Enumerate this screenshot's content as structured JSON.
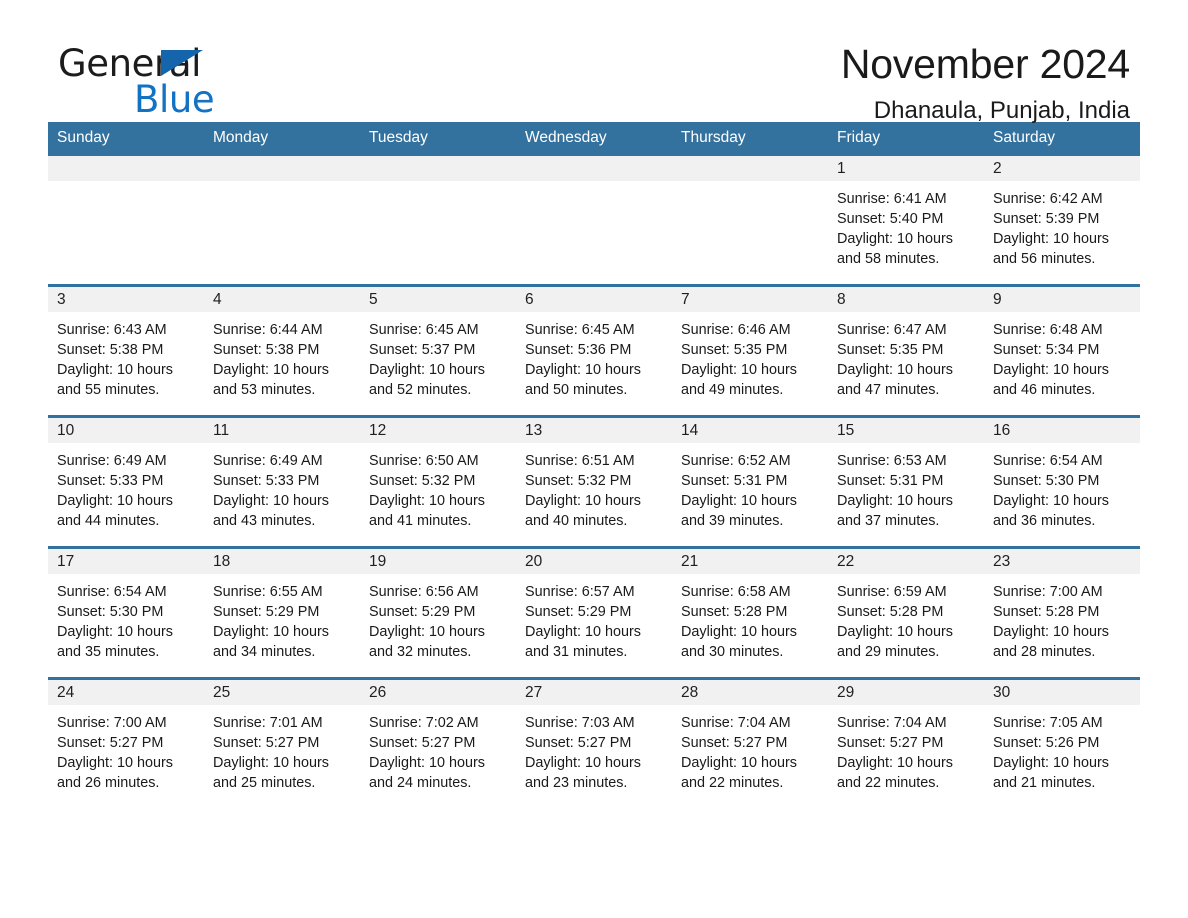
{
  "brand": {
    "line1": "General",
    "line2": "Blue",
    "triangle_icon": "triangle-icon",
    "accent_color": "#1272c4"
  },
  "header": {
    "title": "November 2024",
    "subtitle": "Dhanaula, Punjab, India"
  },
  "theme": {
    "header_blue": "#33719e",
    "daynum_band": "#f1f1f1",
    "text": "#1a1a1a"
  },
  "calendar": {
    "weekday_headers": [
      "Sunday",
      "Monday",
      "Tuesday",
      "Wednesday",
      "Thursday",
      "Friday",
      "Saturday"
    ],
    "weeks": [
      [
        {
          "day": "",
          "empty": true
        },
        {
          "day": "",
          "empty": true
        },
        {
          "day": "",
          "empty": true
        },
        {
          "day": "",
          "empty": true
        },
        {
          "day": "",
          "empty": true
        },
        {
          "day": "1",
          "sunrise": "Sunrise: 6:41 AM",
          "sunset": "Sunset: 5:40 PM",
          "daylight": "Daylight: 10 hours and 58 minutes."
        },
        {
          "day": "2",
          "sunrise": "Sunrise: 6:42 AM",
          "sunset": "Sunset: 5:39 PM",
          "daylight": "Daylight: 10 hours and 56 minutes."
        }
      ],
      [
        {
          "day": "3",
          "sunrise": "Sunrise: 6:43 AM",
          "sunset": "Sunset: 5:38 PM",
          "daylight": "Daylight: 10 hours and 55 minutes."
        },
        {
          "day": "4",
          "sunrise": "Sunrise: 6:44 AM",
          "sunset": "Sunset: 5:38 PM",
          "daylight": "Daylight: 10 hours and 53 minutes."
        },
        {
          "day": "5",
          "sunrise": "Sunrise: 6:45 AM",
          "sunset": "Sunset: 5:37 PM",
          "daylight": "Daylight: 10 hours and 52 minutes."
        },
        {
          "day": "6",
          "sunrise": "Sunrise: 6:45 AM",
          "sunset": "Sunset: 5:36 PM",
          "daylight": "Daylight: 10 hours and 50 minutes."
        },
        {
          "day": "7",
          "sunrise": "Sunrise: 6:46 AM",
          "sunset": "Sunset: 5:35 PM",
          "daylight": "Daylight: 10 hours and 49 minutes."
        },
        {
          "day": "8",
          "sunrise": "Sunrise: 6:47 AM",
          "sunset": "Sunset: 5:35 PM",
          "daylight": "Daylight: 10 hours and 47 minutes."
        },
        {
          "day": "9",
          "sunrise": "Sunrise: 6:48 AM",
          "sunset": "Sunset: 5:34 PM",
          "daylight": "Daylight: 10 hours and 46 minutes."
        }
      ],
      [
        {
          "day": "10",
          "sunrise": "Sunrise: 6:49 AM",
          "sunset": "Sunset: 5:33 PM",
          "daylight": "Daylight: 10 hours and 44 minutes."
        },
        {
          "day": "11",
          "sunrise": "Sunrise: 6:49 AM",
          "sunset": "Sunset: 5:33 PM",
          "daylight": "Daylight: 10 hours and 43 minutes."
        },
        {
          "day": "12",
          "sunrise": "Sunrise: 6:50 AM",
          "sunset": "Sunset: 5:32 PM",
          "daylight": "Daylight: 10 hours and 41 minutes."
        },
        {
          "day": "13",
          "sunrise": "Sunrise: 6:51 AM",
          "sunset": "Sunset: 5:32 PM",
          "daylight": "Daylight: 10 hours and 40 minutes."
        },
        {
          "day": "14",
          "sunrise": "Sunrise: 6:52 AM",
          "sunset": "Sunset: 5:31 PM",
          "daylight": "Daylight: 10 hours and 39 minutes."
        },
        {
          "day": "15",
          "sunrise": "Sunrise: 6:53 AM",
          "sunset": "Sunset: 5:31 PM",
          "daylight": "Daylight: 10 hours and 37 minutes."
        },
        {
          "day": "16",
          "sunrise": "Sunrise: 6:54 AM",
          "sunset": "Sunset: 5:30 PM",
          "daylight": "Daylight: 10 hours and 36 minutes."
        }
      ],
      [
        {
          "day": "17",
          "sunrise": "Sunrise: 6:54 AM",
          "sunset": "Sunset: 5:30 PM",
          "daylight": "Daylight: 10 hours and 35 minutes."
        },
        {
          "day": "18",
          "sunrise": "Sunrise: 6:55 AM",
          "sunset": "Sunset: 5:29 PM",
          "daylight": "Daylight: 10 hours and 34 minutes."
        },
        {
          "day": "19",
          "sunrise": "Sunrise: 6:56 AM",
          "sunset": "Sunset: 5:29 PM",
          "daylight": "Daylight: 10 hours and 32 minutes."
        },
        {
          "day": "20",
          "sunrise": "Sunrise: 6:57 AM",
          "sunset": "Sunset: 5:29 PM",
          "daylight": "Daylight: 10 hours and 31 minutes."
        },
        {
          "day": "21",
          "sunrise": "Sunrise: 6:58 AM",
          "sunset": "Sunset: 5:28 PM",
          "daylight": "Daylight: 10 hours and 30 minutes."
        },
        {
          "day": "22",
          "sunrise": "Sunrise: 6:59 AM",
          "sunset": "Sunset: 5:28 PM",
          "daylight": "Daylight: 10 hours and 29 minutes."
        },
        {
          "day": "23",
          "sunrise": "Sunrise: 7:00 AM",
          "sunset": "Sunset: 5:28 PM",
          "daylight": "Daylight: 10 hours and 28 minutes."
        }
      ],
      [
        {
          "day": "24",
          "sunrise": "Sunrise: 7:00 AM",
          "sunset": "Sunset: 5:27 PM",
          "daylight": "Daylight: 10 hours and 26 minutes."
        },
        {
          "day": "25",
          "sunrise": "Sunrise: 7:01 AM",
          "sunset": "Sunset: 5:27 PM",
          "daylight": "Daylight: 10 hours and 25 minutes."
        },
        {
          "day": "26",
          "sunrise": "Sunrise: 7:02 AM",
          "sunset": "Sunset: 5:27 PM",
          "daylight": "Daylight: 10 hours and 24 minutes."
        },
        {
          "day": "27",
          "sunrise": "Sunrise: 7:03 AM",
          "sunset": "Sunset: 5:27 PM",
          "daylight": "Daylight: 10 hours and 23 minutes."
        },
        {
          "day": "28",
          "sunrise": "Sunrise: 7:04 AM",
          "sunset": "Sunset: 5:27 PM",
          "daylight": "Daylight: 10 hours and 22 minutes."
        },
        {
          "day": "29",
          "sunrise": "Sunrise: 7:04 AM",
          "sunset": "Sunset: 5:27 PM",
          "daylight": "Daylight: 10 hours and 22 minutes."
        },
        {
          "day": "30",
          "sunrise": "Sunrise: 7:05 AM",
          "sunset": "Sunset: 5:26 PM",
          "daylight": "Daylight: 10 hours and 21 minutes."
        }
      ]
    ]
  }
}
